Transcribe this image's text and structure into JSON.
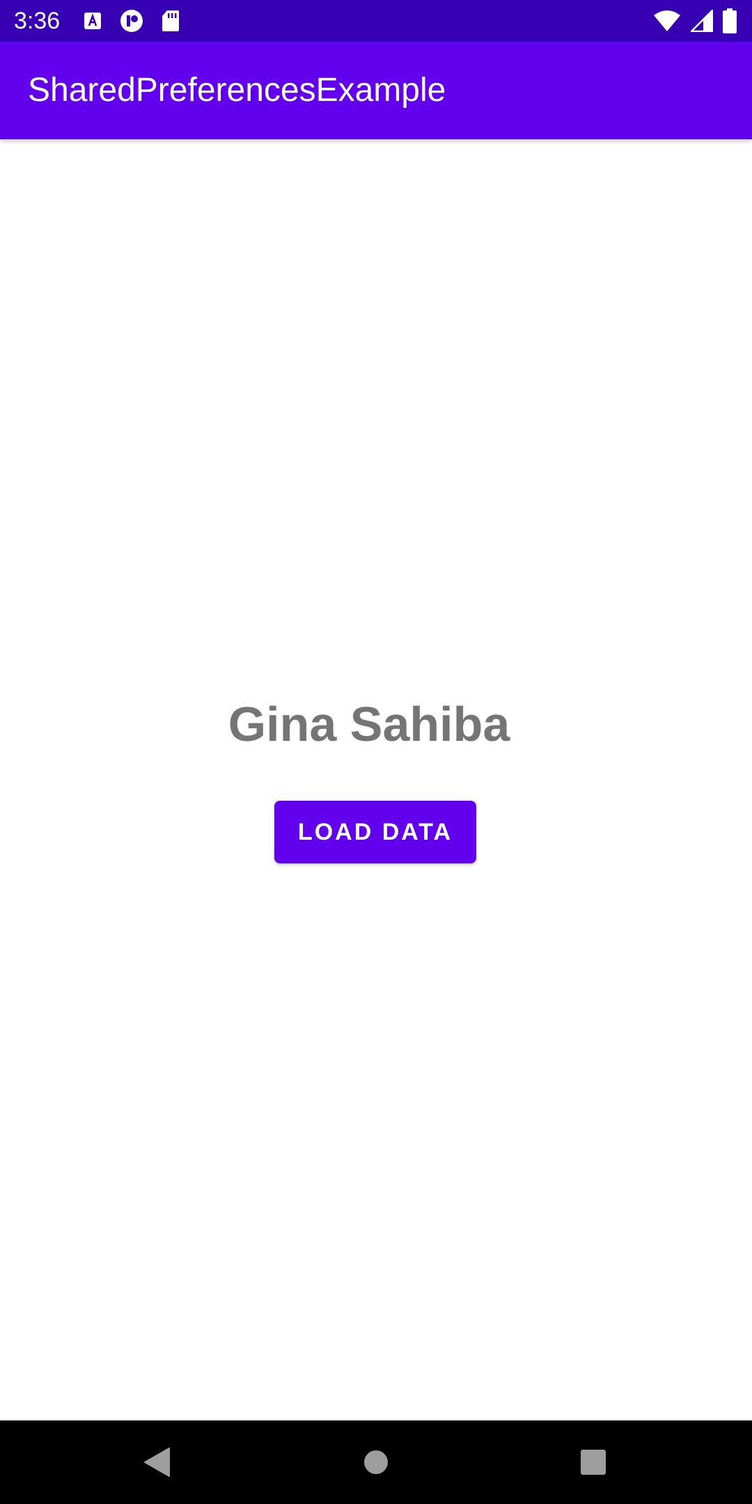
{
  "status_bar": {
    "time": "3:36",
    "left_icons": [
      "a-notification-icon",
      "at-notification-icon",
      "sd-card-icon"
    ],
    "right_icons": [
      "wifi-icon",
      "cell-signal-icon",
      "battery-icon"
    ],
    "background_color": "#3700b3"
  },
  "app_bar": {
    "title": "SharedPreferencesExample",
    "background_color": "#6200ee"
  },
  "main": {
    "name_text": "Gina Sahiba",
    "load_button_label": "LOAD DATA",
    "accent_color": "#6200ee",
    "text_color": "#757575"
  },
  "nav_bar": {
    "buttons": [
      "back-icon",
      "home-icon",
      "recents-icon"
    ]
  }
}
